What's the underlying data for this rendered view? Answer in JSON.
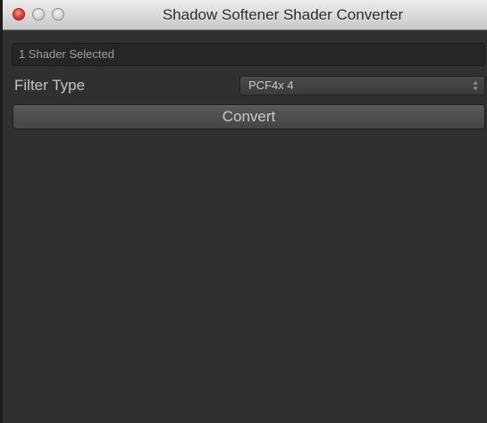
{
  "window": {
    "title": "Shadow Softener Shader Converter",
    "controls": [
      "close-icon",
      "minimize-icon",
      "zoom-icon"
    ]
  },
  "selection": {
    "status": "1 Shader Selected"
  },
  "filter": {
    "label": "Filter Type",
    "selected_value": "PCF4x 4",
    "icon": "up-down-arrows-icon"
  },
  "actions": {
    "convert_label": "Convert"
  },
  "colors": {
    "background": "#303030",
    "titlebar": "#d9d9d9",
    "close": "#e3463a",
    "text": "#c4c4c4"
  }
}
